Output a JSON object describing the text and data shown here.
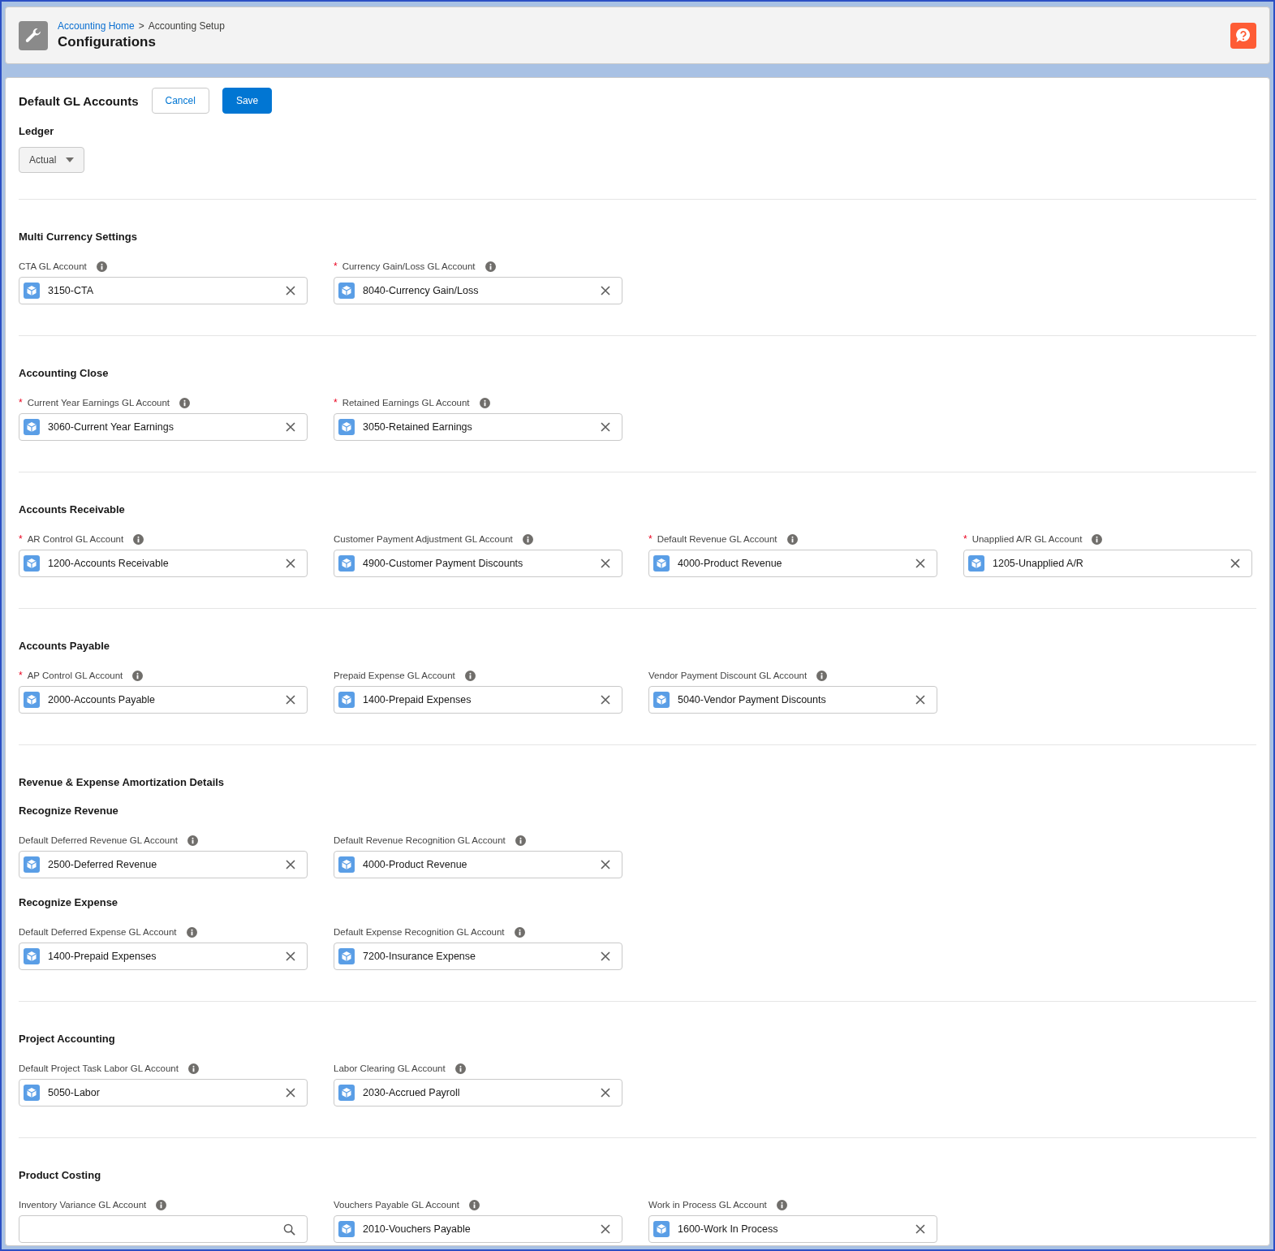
{
  "header": {
    "breadcrumbs": [
      {
        "label": "Accounting Home",
        "link": true
      },
      {
        "label": "Accounting Setup",
        "link": false
      }
    ],
    "separator": ">",
    "title": "Configurations"
  },
  "toolbar": {
    "title": "Default GL Accounts",
    "buttons": [
      {
        "label": "Cancel",
        "kind": "neutral"
      },
      {
        "label": "Save",
        "kind": "brand"
      }
    ]
  },
  "ledger": {
    "label": "Ledger",
    "value": "Actual"
  },
  "required_marker": "*",
  "sections": [
    {
      "title": "Multi Currency Settings",
      "groups": [
        {
          "fields": [
            {
              "label": "CTA GL Account",
              "required": false,
              "value": "3150-CTA"
            },
            {
              "label": "Currency Gain/Loss GL Account",
              "required": true,
              "value": "8040-Currency Gain/Loss"
            }
          ]
        }
      ]
    },
    {
      "title": "Accounting Close",
      "groups": [
        {
          "fields": [
            {
              "label": "Current Year Earnings GL Account",
              "required": true,
              "value": "3060-Current Year Earnings"
            },
            {
              "label": "Retained Earnings GL Account",
              "required": true,
              "value": "3050-Retained Earnings"
            }
          ]
        }
      ]
    },
    {
      "title": "Accounts Receivable",
      "groups": [
        {
          "fields": [
            {
              "label": "AR Control GL Account",
              "required": true,
              "value": "1200-Accounts Receivable"
            },
            {
              "label": "Customer Payment Adjustment GL Account",
              "required": false,
              "value": "4900-Customer Payment Discounts"
            },
            {
              "label": "Default Revenue GL Account",
              "required": true,
              "value": "4000-Product Revenue"
            },
            {
              "label": "Unapplied A/R GL Account",
              "required": true,
              "value": "1205-Unapplied A/R"
            }
          ]
        }
      ]
    },
    {
      "title": "Accounts Payable",
      "groups": [
        {
          "fields": [
            {
              "label": "AP Control GL Account",
              "required": true,
              "value": "2000-Accounts Payable"
            },
            {
              "label": "Prepaid Expense GL Account",
              "required": false,
              "value": "1400-Prepaid Expenses"
            },
            {
              "label": "Vendor Payment Discount GL Account",
              "required": false,
              "value": "5040-Vendor Payment Discounts"
            }
          ]
        }
      ]
    },
    {
      "title": "Revenue & Expense Amortization Details",
      "groups": [
        {
          "title": "Recognize Revenue",
          "fields": [
            {
              "label": "Default Deferred Revenue GL Account",
              "required": false,
              "value": "2500-Deferred Revenue"
            },
            {
              "label": "Default Revenue Recognition GL Account",
              "required": false,
              "value": "4000-Product Revenue"
            }
          ]
        },
        {
          "title": "Recognize Expense",
          "fields": [
            {
              "label": "Default Deferred Expense GL Account",
              "required": false,
              "value": "1400-Prepaid Expenses"
            },
            {
              "label": "Default Expense Recognition GL Account",
              "required": false,
              "value": "7200-Insurance Expense"
            }
          ]
        }
      ]
    },
    {
      "title": "Project Accounting",
      "groups": [
        {
          "fields": [
            {
              "label": "Default Project Task Labor GL Account",
              "required": false,
              "value": "5050-Labor"
            },
            {
              "label": "Labor Clearing GL Account",
              "required": false,
              "value": "2030-Accrued Payroll"
            }
          ]
        }
      ]
    },
    {
      "title": "Product Costing",
      "groups": [
        {
          "fields": [
            {
              "label": "Inventory Variance GL Account",
              "required": false
            },
            {
              "label": "Vouchers Payable GL Account",
              "required": false,
              "value": "2010-Vouchers Payable"
            },
            {
              "label": "Work in Process GL Account",
              "required": false,
              "value": "1600-Work In Process"
            }
          ]
        }
      ]
    }
  ]
}
